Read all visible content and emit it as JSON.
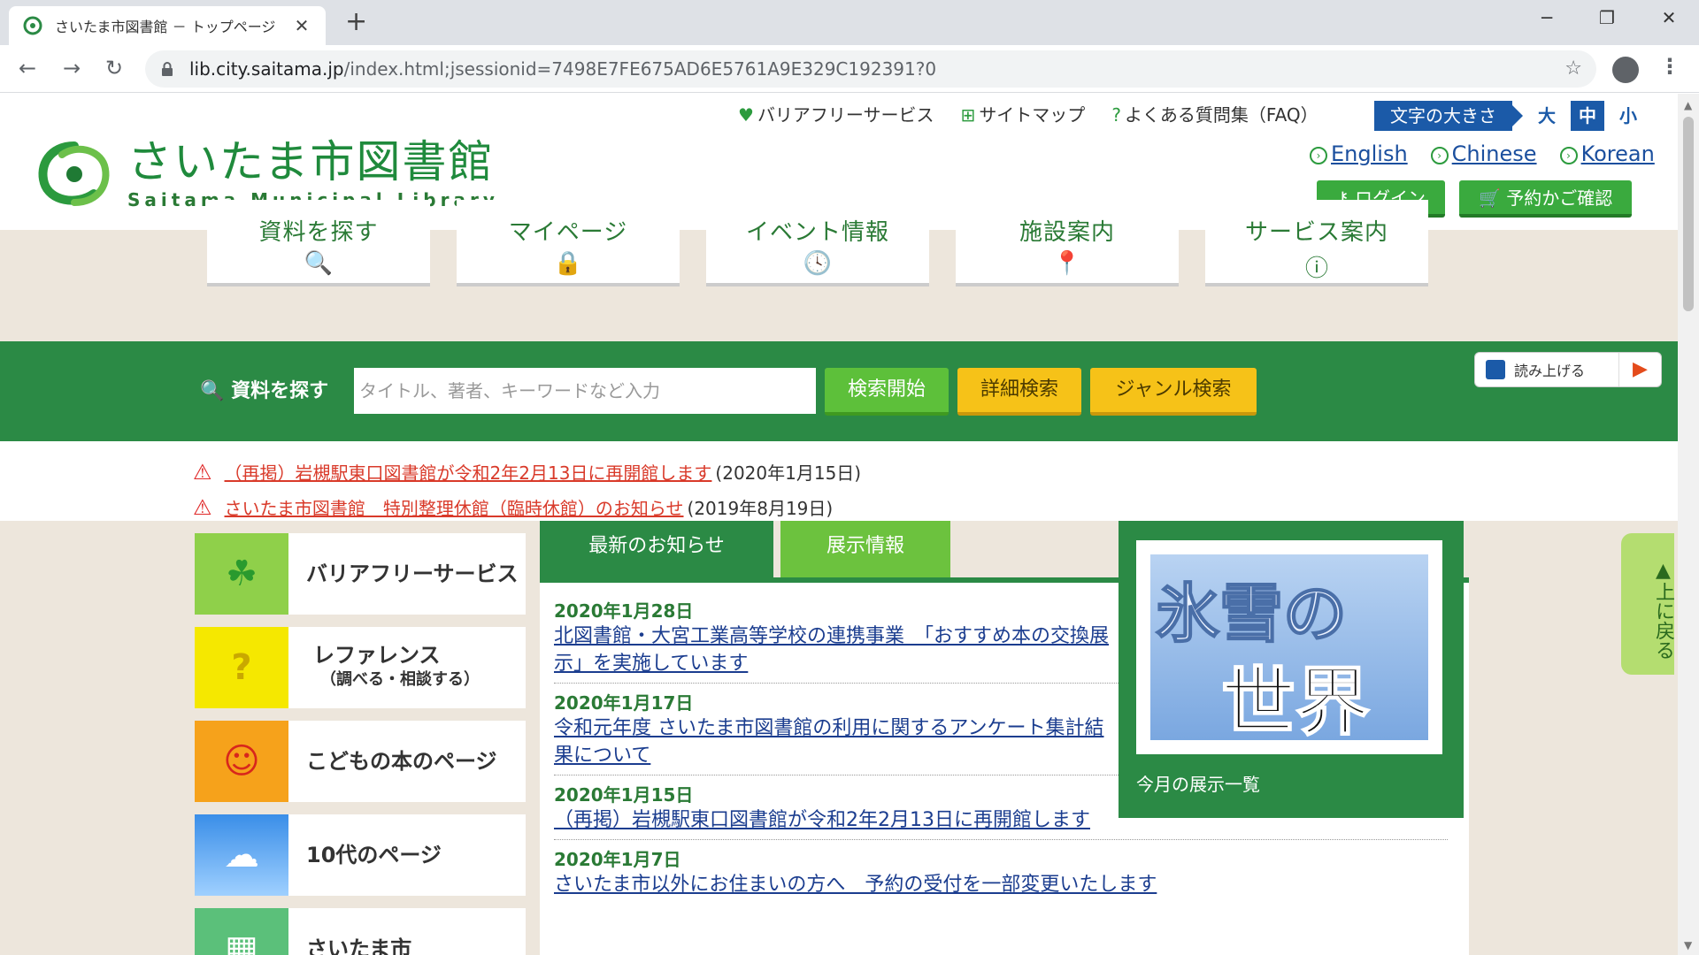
{
  "browser": {
    "tab_title": "さいたま市図書館 － トップページ",
    "new_tab": "+",
    "url_host": "lib.city.saitama.jp",
    "url_path": "/index.html;jsessionid=7498E7FE675AD6E5761A9E329C192391?0",
    "controls": {
      "minimize": "─",
      "maximize": "❐",
      "close": "✕",
      "tab_close": "✕",
      "back": "←",
      "forward": "→",
      "reload": "↻",
      "star": "☆",
      "menu": "⋮"
    }
  },
  "header": {
    "logo_ja": "さいたま市図書館",
    "logo_en": "Saitama Municipal Library",
    "util_links": [
      {
        "icon": "heart-icon",
        "glyph": "♥",
        "label": "バリアフリーサービス"
      },
      {
        "icon": "sitemap-icon",
        "glyph": "⊞",
        "label": "サイトマップ"
      },
      {
        "icon": "question-icon",
        "glyph": "?",
        "label": "よくある質問集（FAQ）"
      }
    ],
    "font_size": {
      "label": "文字の大きさ",
      "large": "大",
      "medium": "中",
      "small": "小",
      "selected": "中"
    },
    "languages": [
      "English",
      "Chinese",
      "Korean"
    ],
    "login": "ログイン",
    "cart": "予約かご確認",
    "colors": {
      "brand_green": "#2b8a45",
      "accent_blue": "#1b5aa8"
    }
  },
  "nav": [
    {
      "label": "資料を探す",
      "icon": "search-icon",
      "glyph": "🔍"
    },
    {
      "label": "マイページ",
      "icon": "lock-icon",
      "glyph": "🔒"
    },
    {
      "label": "イベント情報",
      "icon": "clock-icon",
      "glyph": "🕓"
    },
    {
      "label": "施設案内",
      "icon": "location-icon",
      "glyph": "📍"
    },
    {
      "label": "サービス案内",
      "icon": "info-icon",
      "glyph": "ⓘ"
    }
  ],
  "search": {
    "label": "資料を探す",
    "placeholder": "タイトル、著者、キーワードなど入力",
    "start": "検索開始",
    "detail": "詳細検索",
    "genre": "ジャンル検索",
    "readout": "読み上げる",
    "play": "▶"
  },
  "notices": [
    {
      "text": "（再掲）岩槻駅東口図書館が令和2年2月13日に再開館します",
      "date": "(2020年1月15日)"
    },
    {
      "text": "さいたま市図書館　特別整理休館（臨時休館）のお知らせ",
      "date": "(2019年8月19日)"
    }
  ],
  "side_banners": [
    {
      "label": "バリアフリーサービス",
      "sub": "",
      "glyph": "☘"
    },
    {
      "label": "レファレンス",
      "sub": "（調べる・相談する）",
      "glyph": "?"
    },
    {
      "label": "こどもの本のページ",
      "sub": "",
      "glyph": "☺"
    },
    {
      "label": "10代のページ",
      "sub": "",
      "glyph": "☁"
    },
    {
      "label": "さいたま市",
      "sub": "",
      "glyph": "▦"
    }
  ],
  "tabs": {
    "news": "最新のお知らせ",
    "exhibit": "展示情報"
  },
  "news": [
    {
      "date": "2020年1月28日",
      "title": "北図書館・大宮工業高等学校の連携事業　「おすすめ本の交換展示」を実施しています"
    },
    {
      "date": "2020年1月17日",
      "title": "令和元年度 さいたま市図書館の利用に関するアンケート集計結果について"
    },
    {
      "date": "2020年1月15日",
      "title": "（再掲）岩槻駅東口図書館が令和2年2月13日に再開館します"
    },
    {
      "date": "2020年1月7日",
      "title": "さいたま市以外にお住まいの方へ　予約の受付を一部変更いたします"
    }
  ],
  "exhibit": {
    "title_top": "氷雪の",
    "title_bottom": "世界",
    "caption": "今月の展示一覧"
  },
  "back_to_top": "▲上に戻る"
}
